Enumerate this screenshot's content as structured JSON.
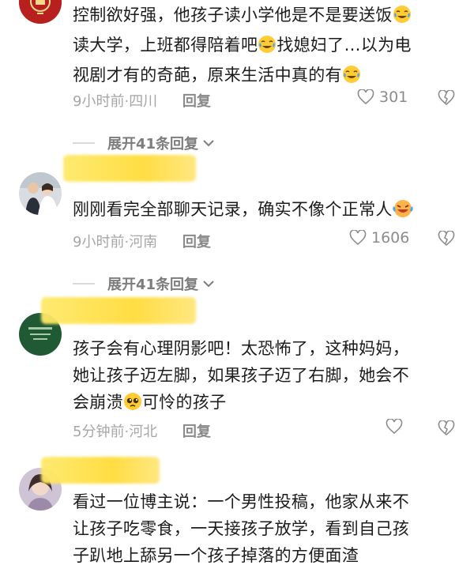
{
  "comments": [
    {
      "text_lines": [
        "控制欲好强，他孩子读小学他是不是要送饭",
        "读大学，上班都得陪着吧",
        "找媳妇了…以为电",
        "视剧才有的奇葩，原来生活中真的有"
      ],
      "time": "9小时前",
      "location": "四川",
      "reply_label": "回复",
      "likes": "301"
    },
    {
      "text_lines": [
        "刚刚看完全部聊天记录，确实不像个正常人"
      ],
      "time": "9小时前",
      "location": "河南",
      "reply_label": "回复",
      "likes": "1606"
    },
    {
      "text_lines": [
        "孩子会有心理阴影吧！太恐怖了，这种妈妈，",
        "她让孩子迈左脚，如果孩子迈了右脚，她会不",
        "会崩溃",
        "可怜的孩子"
      ],
      "time": "5分钟前",
      "location": "河北",
      "reply_label": "回复",
      "likes": ""
    },
    {
      "text_lines": [
        "看过一位博主说：一个男性投稿，他家从来不",
        "让孩子吃零食，一天接孩子放学，看到自己孩",
        "子趴地上舔另一个孩子掉落的方便面渣"
      ]
    }
  ],
  "expand_replies": [
    "展开41条回复",
    "展开41条回复"
  ],
  "separator": "·",
  "icons": {
    "like": "heart-outline-icon",
    "dislike": "broken-heart-icon",
    "chevron": "chevron-down-icon",
    "emoji_cry_laugh": "tears-of-joy-emoji-icon",
    "emoji_pleading": "pleading-face-emoji-icon"
  }
}
